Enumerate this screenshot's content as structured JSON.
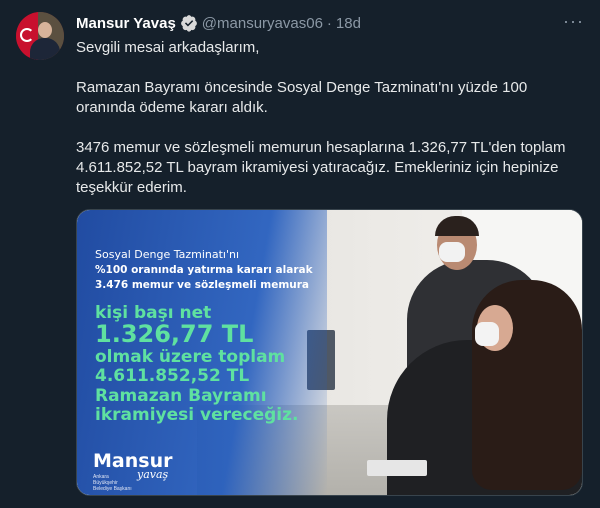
{
  "tweet": {
    "author_name": "Mansur Yavaş",
    "handle": "@mansuryavas06",
    "separator": "·",
    "time": "18d",
    "more_icon": "more-icon",
    "paragraphs": [
      "Sevgili mesai arkadaşlarım,",
      "Ramazan Bayramı öncesinde Sosyal Denge Tazminatı'nı yüzde 100 oranında ödeme kararı aldık.",
      "3476 memur ve sözleşmeli memurun hesaplarına 1.326,77 TL'den toplam 4.611.852,52 TL bayram ikramiyesi yatıracağız. Emekleriniz için hepinize teşekkür ederim."
    ]
  },
  "media": {
    "line1": "Sosyal Denge Tazminatı'nı",
    "line2": "%100 oranında yatırma kararı alarak",
    "line3": "3.476 memur ve sözleşmeli memura",
    "line4": "kişi başı net",
    "line5": "1.326,77 TL",
    "line6": "olmak üzere toplam",
    "line7": "4.611.852,52 TL",
    "line8": "Ramazan Bayramı",
    "line9": "ikramiyesi vereceğiz.",
    "logo_brand": "Mansur",
    "logo_script": "yavaş",
    "logo_sub": "Ankara Büyükşehir Belediye Başkanı"
  },
  "colors": {
    "background": "#15202b",
    "handle": "#8b98a5",
    "verified": "#d9d9d9",
    "overlay_blue": "#1b47a0",
    "highlight_green": "#5fe1a0"
  }
}
